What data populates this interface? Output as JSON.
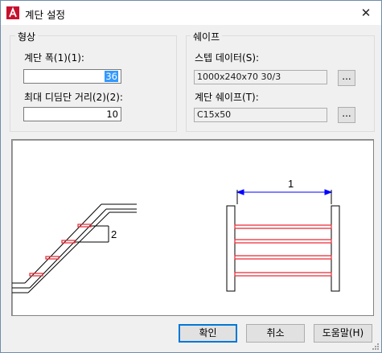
{
  "window": {
    "title": "계단 설정",
    "close_glyph": "✕"
  },
  "shape_group": {
    "title": "형상",
    "width_label": "계단 폭(1)(1):",
    "width_value": "36",
    "max_dist_label": "최대 디딤단 거리(2)(2):",
    "max_dist_value": "10"
  },
  "profile_group": {
    "title": "쉐이프",
    "step_data_label": "스텝 데이터(S):",
    "step_data_value": "1000x240x70 30/3",
    "stair_shape_label": "계단 쉐이프(T):",
    "stair_shape_value": "C15x50",
    "browse_label": "..."
  },
  "preview": {
    "dim_label_1": "1",
    "dim_label_2": "2",
    "colors": {
      "tread": "#e8323c",
      "dimension": "#0000ff",
      "structure": "#000000"
    }
  },
  "buttons": {
    "ok": "확인",
    "cancel": "취소",
    "help": "도움말(H)"
  }
}
